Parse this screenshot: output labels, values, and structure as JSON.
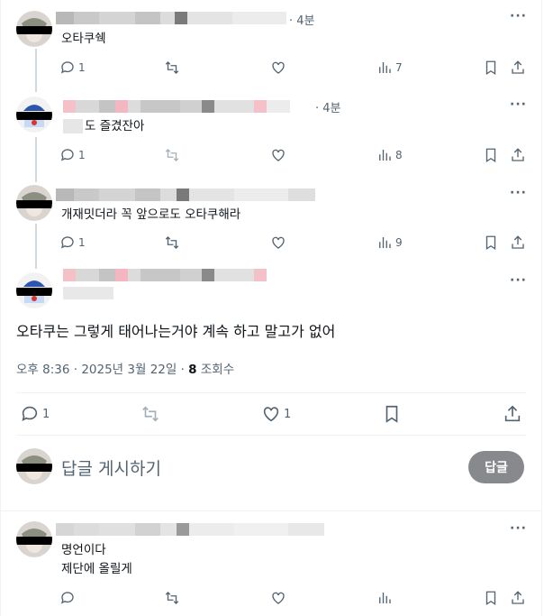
{
  "tweets": [
    {
      "time": "· 4분",
      "lines": [
        "오타쿠쉑"
      ],
      "reply_count": "1",
      "view_count": "7"
    },
    {
      "time": "· 4분",
      "lines": [
        "도 즐겼잔아"
      ],
      "reply_count": "1",
      "view_count": "8"
    },
    {
      "lines": [
        "개재밋더라 꼭 앞으로도 오타쿠해라"
      ],
      "reply_count": "1",
      "view_count": "9"
    }
  ],
  "main_tweet": {
    "text": "오타쿠는 그렇게 태어나는거야 계속 하고 말고가 없어",
    "timestamp": "오후 8:36 · 2025년 3월 22일 · ",
    "views_number": "8",
    "views_label": " 조회수",
    "reply_count": "1",
    "like_count": "1"
  },
  "composer": {
    "placeholder": "답글 게시하기",
    "button_label": "답글"
  },
  "reply": {
    "lines": [
      "명언이다",
      "제단에 올릴게"
    ]
  },
  "icons": [
    "reply-icon",
    "retweet-icon",
    "like-icon",
    "views-icon",
    "bookmark-icon",
    "share-icon",
    "more-icon"
  ],
  "colors": {
    "icon": "#536471",
    "text": "#0f1419",
    "button": "#87898c",
    "thread_line": "#cfd9de"
  }
}
